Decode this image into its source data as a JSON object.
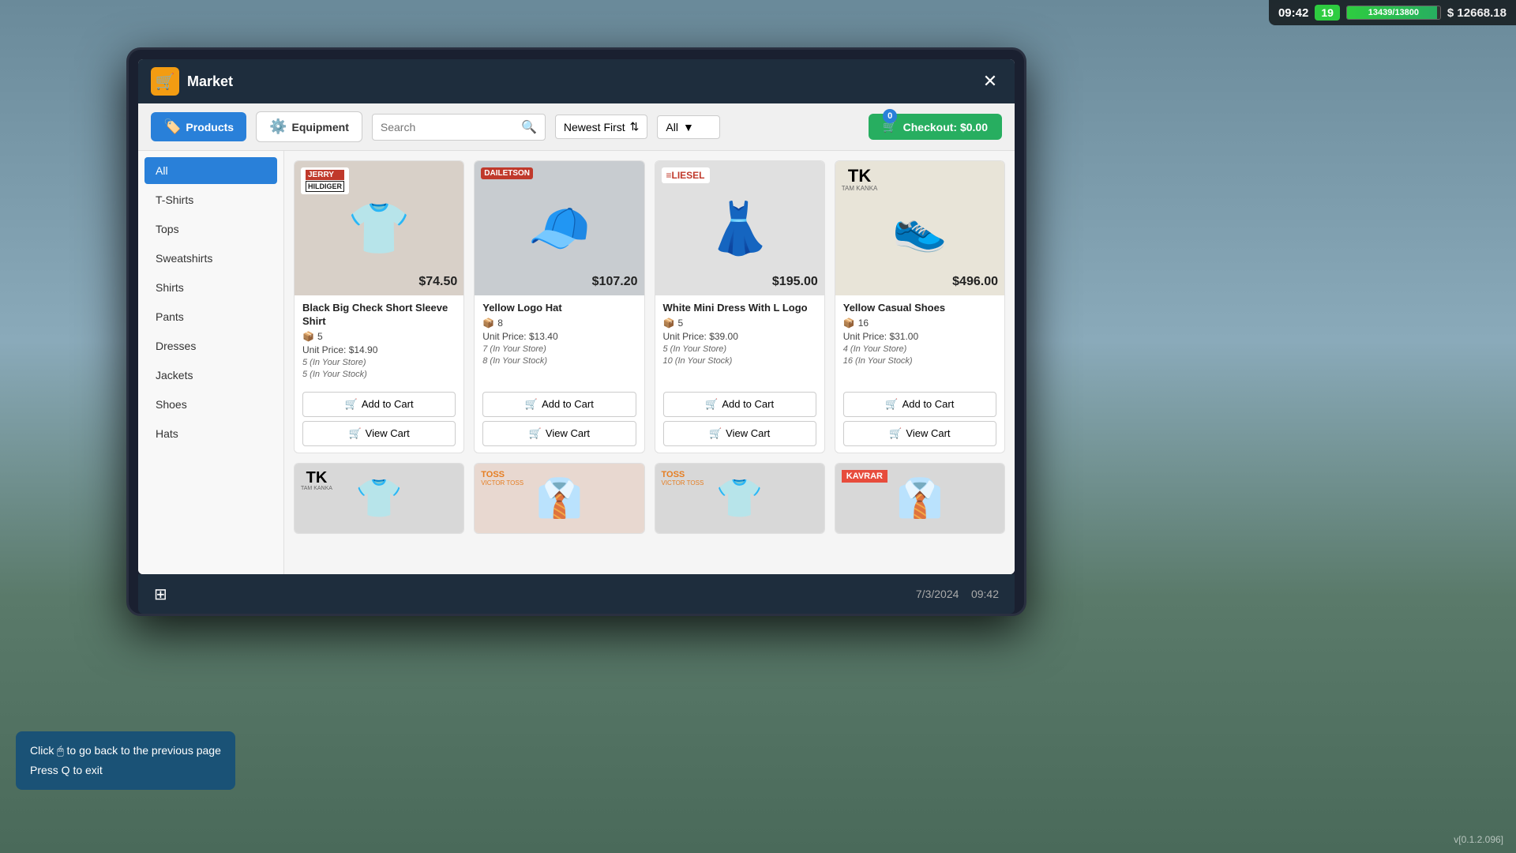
{
  "hud": {
    "time": "09:42",
    "level": "19",
    "xp_current": "13439",
    "xp_max": "13800",
    "xp_display": "13439/13800",
    "xp_percent": 97,
    "money": "$ 12668.18"
  },
  "market": {
    "title": "Market",
    "tabs": [
      {
        "label": "Products",
        "id": "products",
        "active": true
      },
      {
        "label": "Equipment",
        "id": "equipment",
        "active": false
      }
    ],
    "search": {
      "placeholder": "Search"
    },
    "sort": {
      "value": "Newest First"
    },
    "filter": {
      "value": "All"
    },
    "checkout": {
      "label": "Checkout: $0.00",
      "badge": "0"
    }
  },
  "sidebar": {
    "categories": [
      {
        "label": "All",
        "active": true
      },
      {
        "label": "T-Shirts",
        "active": false
      },
      {
        "label": "Tops",
        "active": false
      },
      {
        "label": "Sweatshirts",
        "active": false
      },
      {
        "label": "Shirts",
        "active": false
      },
      {
        "label": "Pants",
        "active": false
      },
      {
        "label": "Dresses",
        "active": false
      },
      {
        "label": "Jackets",
        "active": false
      },
      {
        "label": "Shoes",
        "active": false
      },
      {
        "label": "Hats",
        "active": false
      }
    ]
  },
  "products": [
    {
      "brand": "JERRY\nHILDIGER",
      "brand_display": "JERRY HILDIGER",
      "price": "$74.50",
      "name": "Black Big Check Short Sleeve Shirt",
      "qty_box": "5",
      "unit_price": "$14.90",
      "in_store": "5 (In Your Store)",
      "in_stock": "5 (In Your Stock)",
      "image_emoji": "👕",
      "image_color": "#c8c8c8",
      "brand_style": "jerry",
      "add_cart": "Add to Cart",
      "view_cart": "View Cart"
    },
    {
      "brand": "DAILETSON",
      "brand_display": "DAILETSON",
      "price": "$107.20",
      "name": "Yellow Logo Hat",
      "qty_box": "8",
      "unit_price": "$13.40",
      "in_store": "7 (In Your Store)",
      "in_stock": "8 (In Your Stock)",
      "image_emoji": "🧢",
      "image_color": "#d0d0d0",
      "brand_style": "dailetson",
      "add_cart": "Add to Cart",
      "view_cart": "View Cart"
    },
    {
      "brand": "LIESEL",
      "brand_display": "LIESEL",
      "price": "$195.00",
      "name": "White Mini Dress With L Logo",
      "qty_box": "5",
      "unit_price": "$39.00",
      "in_store": "5 (In Your Store)",
      "in_stock": "10 (In Your Stock)",
      "image_emoji": "👗",
      "image_color": "#e0e0e0",
      "brand_style": "liesel",
      "add_cart": "Add to Cart",
      "view_cart": "View Cart"
    },
    {
      "brand": "TK",
      "brand_sub": "TAM KANKA",
      "brand_display": "TK TAM KANKA",
      "price": "$496.00",
      "name": "Yellow Casual Shoes",
      "qty_box": "16",
      "unit_price": "$31.00",
      "in_store": "4 (In Your Store)",
      "in_stock": "16 (In Your Stock)",
      "image_emoji": "👟",
      "image_color": "#e8e0c8",
      "brand_style": "tk",
      "add_cart": "Add to Cart",
      "view_cart": "View Cart"
    }
  ],
  "second_row_brands": [
    {
      "brand": "TK\nTAM KANKA",
      "style": "tk"
    },
    {
      "brand": "TOSS\nVICTOR TOSS",
      "style": "toss"
    },
    {
      "brand": "TOSS\nVICTOR TOSS",
      "style": "toss"
    },
    {
      "brand": "KAVRAR",
      "style": "kavrar"
    }
  ],
  "bottom": {
    "date": "7/3/2024",
    "time": "09:42"
  },
  "instruction": {
    "line1": "Click 🖱 to go back to the previous page",
    "line2": "Press Q to exit"
  },
  "version": "v[0.1.2.096]"
}
